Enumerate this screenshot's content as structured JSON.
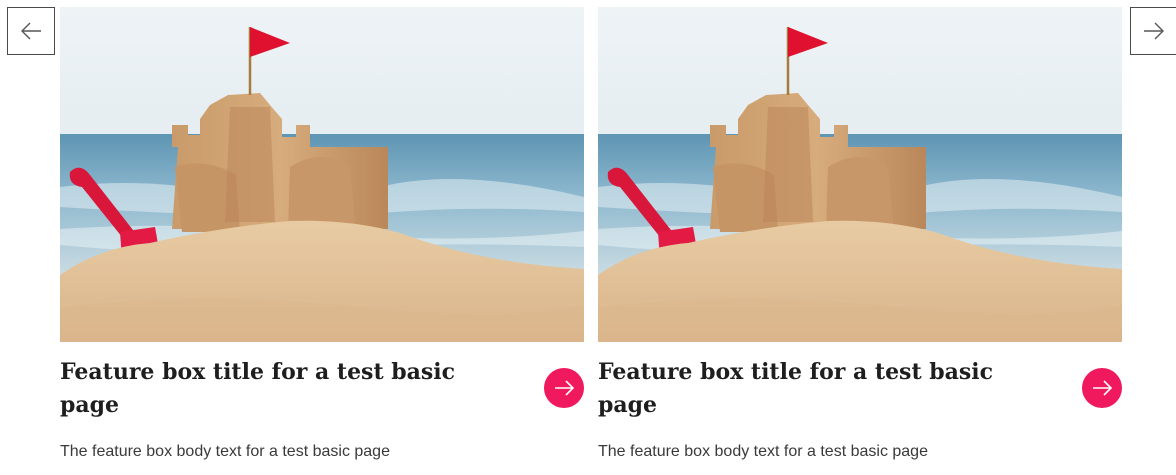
{
  "carousel": {
    "prev_icon": "arrow-left-icon",
    "next_icon": "arrow-right-icon"
  },
  "cards": [
    {
      "image_alt": "sandcastle-on-beach",
      "title": "Feature box title for a test basic page",
      "body": "The feature box body text for a test basic page",
      "link_icon": "arrow-right-icon"
    },
    {
      "image_alt": "sandcastle-on-beach",
      "title": "Feature box title for a test basic page",
      "body": "The feature box body text for a test basic page",
      "link_icon": "arrow-right-icon"
    }
  ],
  "colors": {
    "accent": "#f0195e",
    "title": "#1e1e1e",
    "body": "#3a3a3a"
  }
}
